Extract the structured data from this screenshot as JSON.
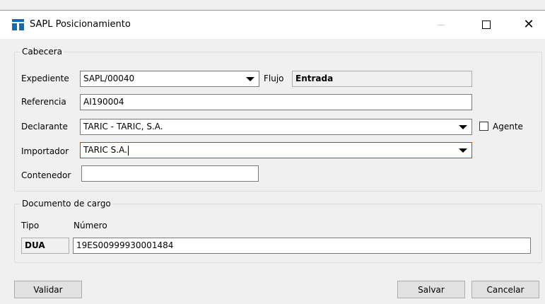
{
  "window": {
    "title": "SAPL Posicionamiento",
    "minimize": "—",
    "close": "✕"
  },
  "cabecera": {
    "legend": "Cabecera",
    "expediente": {
      "label": "Expediente",
      "value": "SAPL/00040"
    },
    "flujo": {
      "label": "Flujo",
      "value": "Entrada"
    },
    "referencia": {
      "label": "Referencia",
      "value": "AI190004"
    },
    "declarante": {
      "label": "Declarante",
      "value": "TARIC - TARIC, S.A."
    },
    "agente": {
      "label": "Agente",
      "checked": false
    },
    "importador": {
      "label": "Importador",
      "value": "TARIC S.A."
    },
    "contenedor": {
      "label": "Contenedor",
      "value": ""
    }
  },
  "documento": {
    "legend": "Documento de cargo",
    "tipo_label": "Tipo",
    "numero_label": "Número",
    "tipo_value": "DUA",
    "numero_value": "19ES00999930001484"
  },
  "buttons": {
    "validar": "Validar",
    "salvar": "Salvar",
    "cancelar": "Cancelar"
  },
  "icons": [
    "app-logo-icon",
    "minimize-icon",
    "maximize-icon",
    "close-icon",
    "chevron-down-icon"
  ]
}
